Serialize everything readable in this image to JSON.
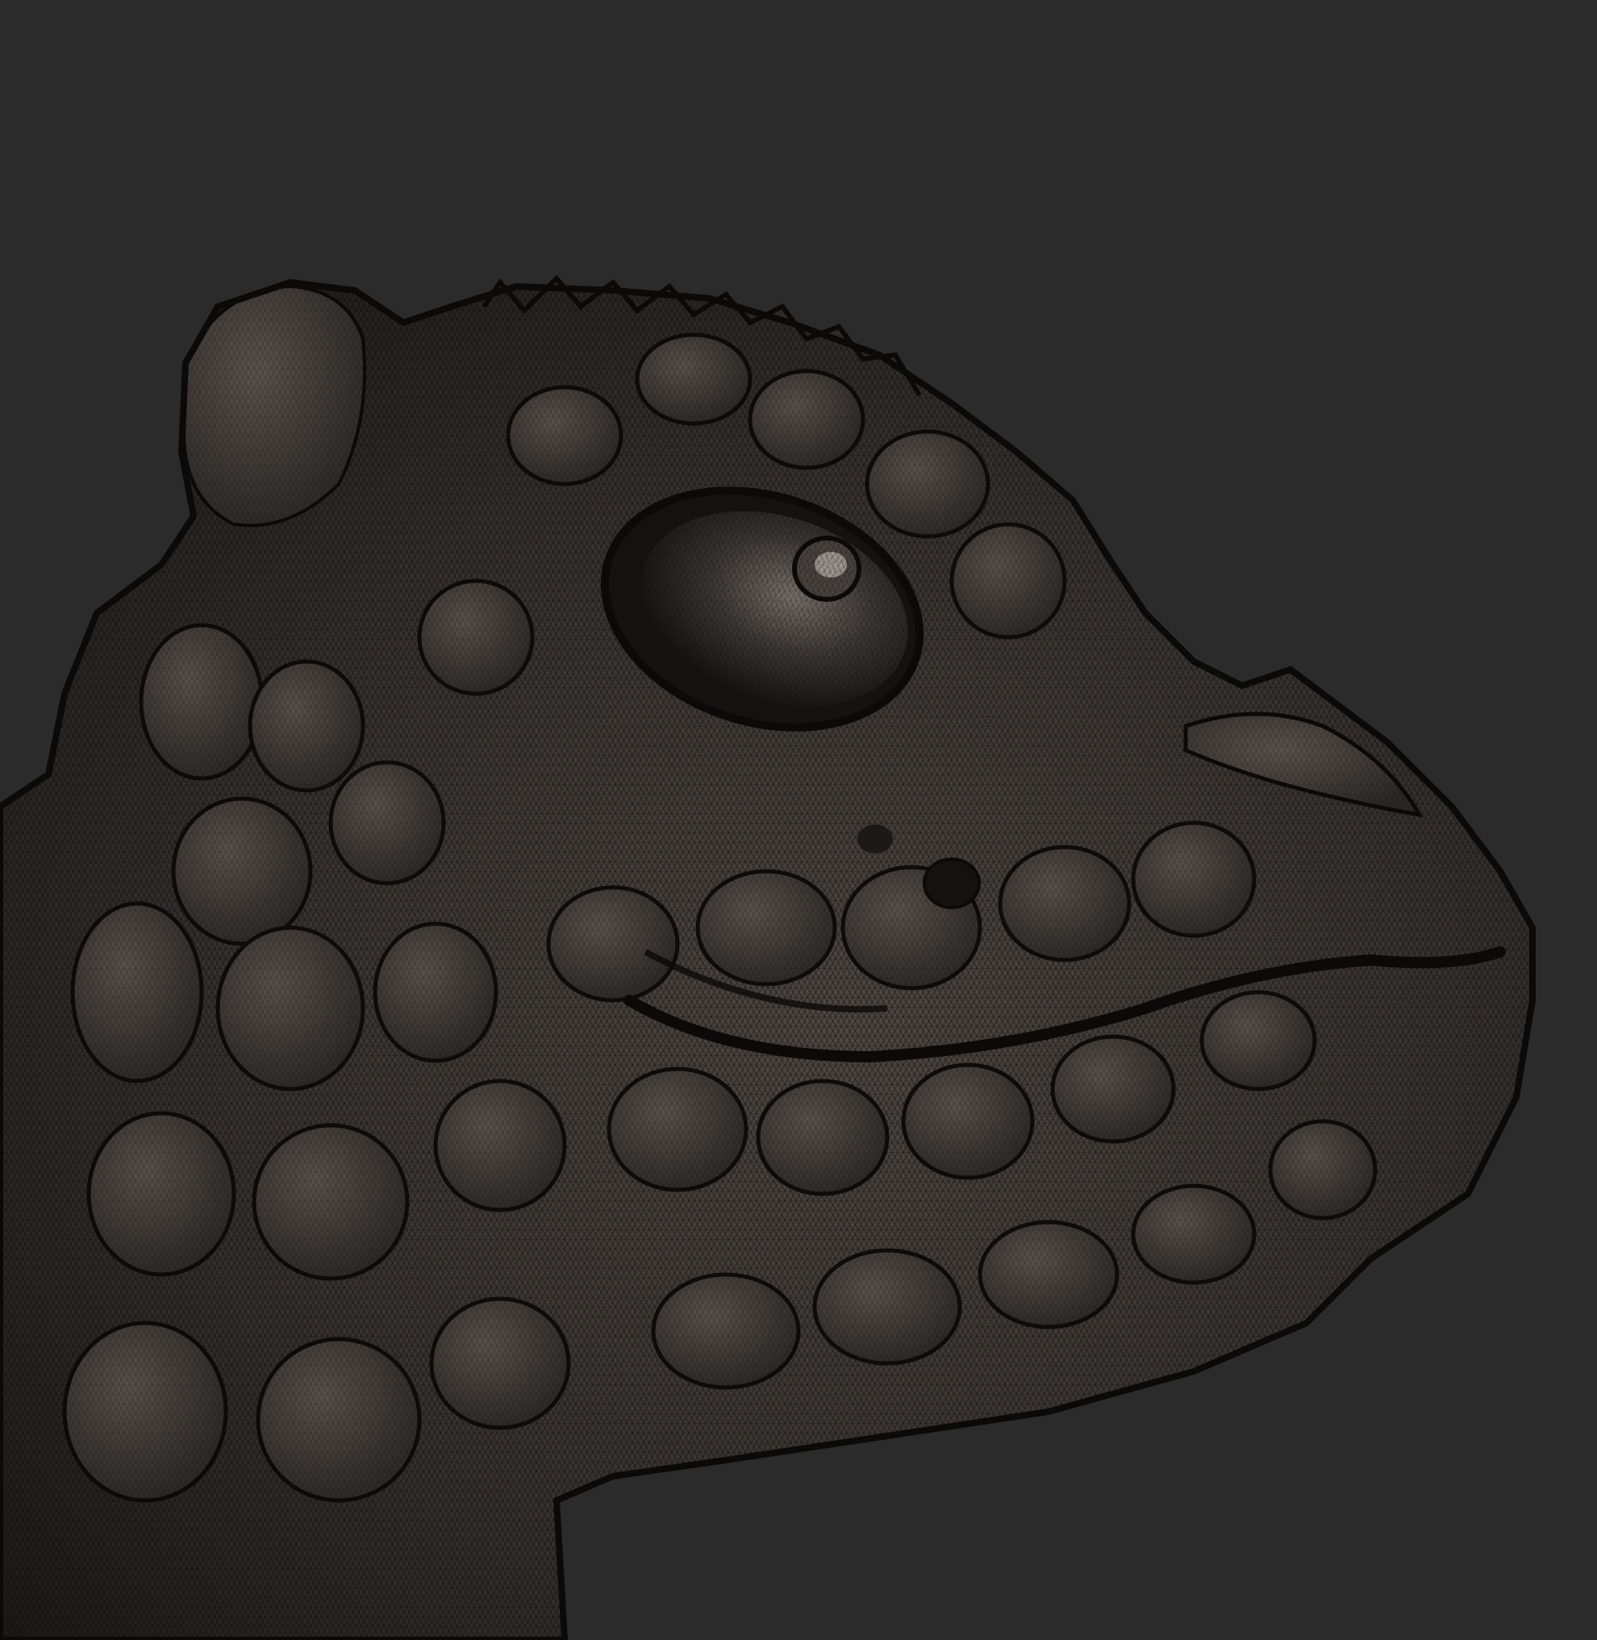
{
  "viewport": {
    "background_color": "#2b2b2b",
    "model": {
      "subject": "reptile-head-sculpt",
      "display_mode": "wireframe-on-shaded",
      "base_color": "#2f2c2a",
      "highlight_color": "#6b625b",
      "wire_color": "#0b0a09"
    }
  }
}
